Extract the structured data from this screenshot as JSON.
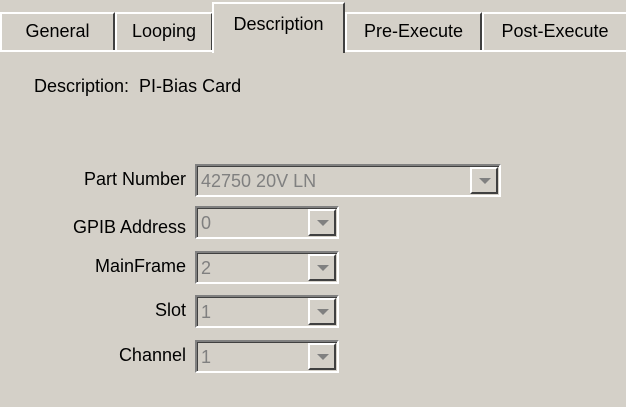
{
  "tabs": [
    {
      "label": "General"
    },
    {
      "label": "Looping"
    },
    {
      "label": "Description"
    },
    {
      "label": "Pre-Execute"
    },
    {
      "label": "Post-Execute"
    }
  ],
  "description": {
    "label": "Description:",
    "value": "PI-Bias Card"
  },
  "fields": {
    "part_number": {
      "label": "Part Number",
      "value": "42750 20V  LN"
    },
    "gpib_address": {
      "label": "GPIB Address",
      "value": "0"
    },
    "mainframe": {
      "label": "MainFrame",
      "value": "2"
    },
    "slot": {
      "label": "Slot",
      "value": "1"
    },
    "channel": {
      "label": "Channel",
      "value": "1"
    }
  },
  "colors": {
    "background": "#d4d0c8",
    "disabled_text": "#808080"
  }
}
